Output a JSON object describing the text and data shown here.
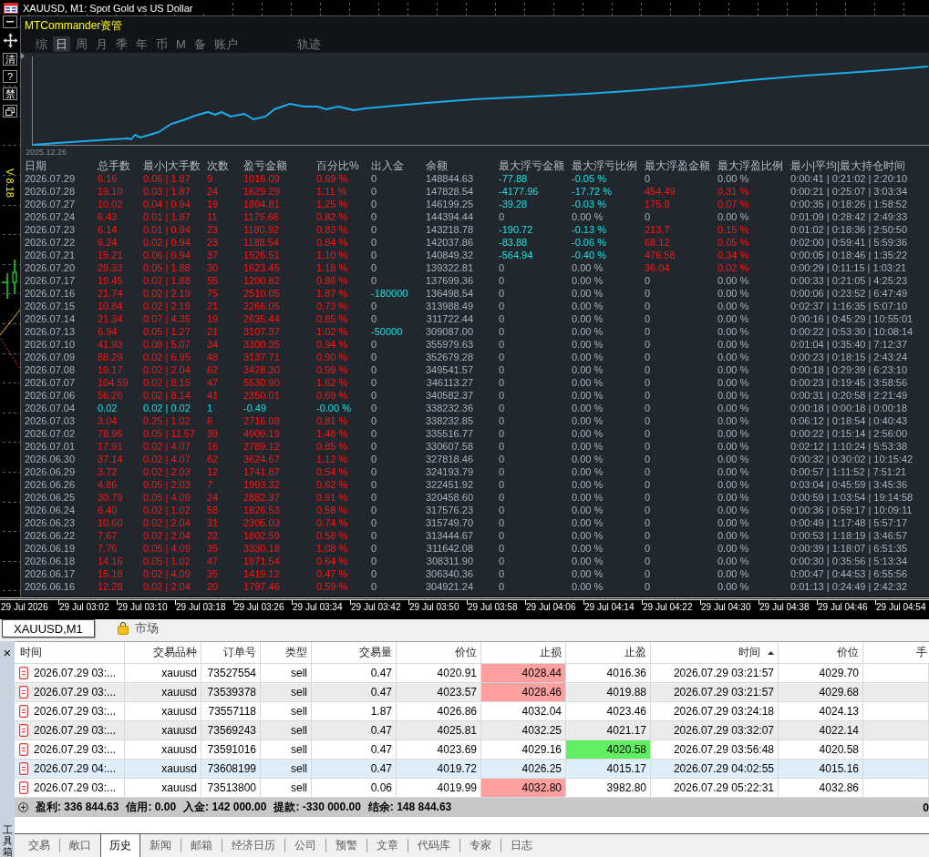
{
  "title_bar": {
    "title": "XAUUSD, M1: Spot Gold vs US Dollar"
  },
  "side_tools": [
    {
      "kind": "minimize"
    },
    {
      "kind": "move"
    },
    {
      "kind": "label",
      "label": "清"
    },
    {
      "kind": "label",
      "label": "?"
    },
    {
      "kind": "label",
      "label": "禁"
    },
    {
      "kind": "restore"
    }
  ],
  "version": "V 8.18",
  "panel": {
    "title": "MTCommander资管",
    "tabs": [
      {
        "label": "综",
        "selected": false
      },
      {
        "label": "日",
        "selected": true
      },
      {
        "label": "周",
        "selected": false
      },
      {
        "label": "月",
        "selected": false
      },
      {
        "label": "季",
        "selected": false
      },
      {
        "label": "年",
        "selected": false
      },
      {
        "label": "币",
        "selected": false
      },
      {
        "label": "M",
        "selected": false
      },
      {
        "label": "备",
        "selected": false
      },
      {
        "label": "账户",
        "selected": false
      }
    ],
    "side_tabs": [
      {
        "label": "轨迹",
        "selected": false
      }
    ],
    "chart_start": "2025.12.26"
  },
  "stats": {
    "columns": [
      "日期",
      "总手数",
      "最小|大手数",
      "次数",
      "盈亏金额",
      "百分比%",
      "出入金",
      "余额",
      "最大浮亏金额",
      "最大浮亏比例",
      "最大浮盈金额",
      "最大浮盈比例",
      "最小|平均|最大持仓时间"
    ],
    "rows": [
      {
        "cells": [
          "2026.07.29",
          "6.16",
          "0.06 | 1.87",
          "9",
          "1016.09",
          "0.69 %",
          "0",
          "148844.63",
          "-77.88",
          "-0.05 %",
          "0",
          "0.00 %",
          "0:00:41 | 0:21:02 | 2:20:10"
        ],
        "negative": false,
        "flow_marked": false,
        "float_loss_marked": true,
        "float_gain_marked": false
      },
      {
        "cells": [
          "2026.07.28",
          "19.10",
          "0.03 | 1.87",
          "24",
          "1629.29",
          "1.11 %",
          "0",
          "147828.54",
          "-4177.96",
          "-17.72 %",
          "454.49",
          "0.31 %",
          "0:00:21 | 0:25:07 | 3:03:34"
        ],
        "negative": false,
        "flow_marked": false,
        "float_loss_marked": true,
        "float_gain_marked": true
      },
      {
        "cells": [
          "2026.07.27",
          "10.02",
          "0.04 | 0.94",
          "19",
          "1804.81",
          "1.25 %",
          "0",
          "146199.25",
          "-39.28",
          "-0.03 %",
          "175.8",
          "0.07 %",
          "0:00:35 | 0:18:26 | 1:58:52"
        ],
        "negative": false,
        "flow_marked": false,
        "float_loss_marked": true,
        "float_gain_marked": true
      },
      {
        "cells": [
          "2026.07.24",
          "6.43",
          "0.01 | 1.87",
          "11",
          "1175.66",
          "0.82 %",
          "0",
          "144394.44",
          "0",
          "0.00 %",
          "0",
          "0.00 %",
          "0:01:09 | 0:28:42 | 2:49:33"
        ],
        "negative": false,
        "flow_marked": false,
        "float_loss_marked": false,
        "float_gain_marked": false
      },
      {
        "cells": [
          "2026.07.23",
          "6.14",
          "0.01 | 0.94",
          "23",
          "1180.92",
          "0.83 %",
          "0",
          "143218.78",
          "-190.72",
          "-0.13 %",
          "213.7",
          "0.15 %",
          "0:01:02 | 0:18:36 | 2:50:50"
        ],
        "negative": false,
        "flow_marked": false,
        "float_loss_marked": true,
        "float_gain_marked": true
      },
      {
        "cells": [
          "2026.07.22",
          "6.24",
          "0.02 | 0.94",
          "23",
          "1188.54",
          "0.84 %",
          "0",
          "142037.86",
          "-83.88",
          "-0.06 %",
          "68.12",
          "0.05 %",
          "0:02:00 | 0:59:41 | 5:59:36"
        ],
        "negative": false,
        "flow_marked": false,
        "float_loss_marked": true,
        "float_gain_marked": true
      },
      {
        "cells": [
          "2026.07.21",
          "15.21",
          "0.06 | 0.94",
          "37",
          "1526.51",
          "1.10 %",
          "0",
          "140849.32",
          "-564.94",
          "-0.40 %",
          "476.58",
          "0.34 %",
          "0:00:05 | 0:18:46 | 1:35:22"
        ],
        "negative": false,
        "flow_marked": false,
        "float_loss_marked": true,
        "float_gain_marked": true
      },
      {
        "cells": [
          "2026.07.20",
          "28.33",
          "0.05 | 1.88",
          "30",
          "1623.45",
          "1.18 %",
          "0",
          "139322.81",
          "0",
          "0.00 %",
          "36.04",
          "0.02 %",
          "0:00:29 | 0:11:15 | 1:03:21"
        ],
        "negative": false,
        "flow_marked": false,
        "float_loss_marked": false,
        "float_gain_marked": true
      },
      {
        "cells": [
          "2026.07.17",
          "19.45",
          "0.02 | 1.88",
          "55",
          "1200.82",
          "0.88 %",
          "0",
          "137699.36",
          "0",
          "0.00 %",
          "0",
          "0.00 %",
          "0:00:33 | 0:21:05 | 4:25:23"
        ],
        "negative": false,
        "flow_marked": false,
        "float_loss_marked": false,
        "float_gain_marked": false
      },
      {
        "cells": [
          "2026.07.16",
          "21.74",
          "0.02 | 2.19",
          "75",
          "2510.05",
          "1.87 %",
          "-180000",
          "136498.54",
          "0",
          "0.00 %",
          "0",
          "0.00 %",
          "0:00:06 | 0:23:52 | 6:47:49"
        ],
        "negative": false,
        "flow_marked": true,
        "float_loss_marked": false,
        "float_gain_marked": false
      },
      {
        "cells": [
          "2026.07.15",
          "10.84",
          "0.02 | 2.19",
          "21",
          "2266.05",
          "0.73 %",
          "0",
          "313988.49",
          "0",
          "0.00 %",
          "0",
          "0.00 %",
          "0:02:37 | 1:16:35 | 5:07:10"
        ],
        "negative": false,
        "flow_marked": false,
        "float_loss_marked": false,
        "float_gain_marked": false
      },
      {
        "cells": [
          "2026.07.14",
          "21.34",
          "0.07 | 4.35",
          "19",
          "2635.44",
          "0.85 %",
          "0",
          "311722.44",
          "0",
          "0.00 %",
          "0",
          "0.00 %",
          "0:00:16 | 0:45:29 | 10:55:01"
        ],
        "negative": false,
        "flow_marked": false,
        "float_loss_marked": false,
        "float_gain_marked": false
      },
      {
        "cells": [
          "2026.07.13",
          "6.94",
          "0.05 | 1.27",
          "21",
          "3107.37",
          "1.02 %",
          "-50000",
          "309087.00",
          "0",
          "0.00 %",
          "0",
          "0.00 %",
          "0:00:22 | 0:53:30 | 10:08:14"
        ],
        "negative": false,
        "flow_marked": true,
        "float_loss_marked": false,
        "float_gain_marked": false
      },
      {
        "cells": [
          "2026.07.10",
          "41.93",
          "0.08 | 5.07",
          "34",
          "3300.35",
          "0.94 %",
          "0",
          "355979.63",
          "0",
          "0.00 %",
          "0",
          "0.00 %",
          "0:01:04 | 0:35:40 | 7:12:37"
        ],
        "negative": false,
        "flow_marked": false,
        "float_loss_marked": false,
        "float_gain_marked": false
      },
      {
        "cells": [
          "2026.07.09",
          "88.29",
          "0.02 | 6.95",
          "48",
          "3137.71",
          "0.90 %",
          "0",
          "352679.28",
          "0",
          "0.00 %",
          "0",
          "0.00 %",
          "0:00:23 | 0:18:15 | 2:43:24"
        ],
        "negative": false,
        "flow_marked": false,
        "float_loss_marked": false,
        "float_gain_marked": false
      },
      {
        "cells": [
          "2026.07.08",
          "19.17",
          "0.02 | 2.04",
          "62",
          "3428.30",
          "0.99 %",
          "0",
          "349541.57",
          "0",
          "0.00 %",
          "0",
          "0.00 %",
          "0:00:18 | 0:29:39 | 6:23:10"
        ],
        "negative": false,
        "flow_marked": false,
        "float_loss_marked": false,
        "float_gain_marked": false
      },
      {
        "cells": [
          "2026.07.07",
          "104.59",
          "0.02 | 8.15",
          "47",
          "5530.90",
          "1.62 %",
          "0",
          "346113.27",
          "0",
          "0.00 %",
          "0",
          "0.00 %",
          "0:00:23 | 0:19:45 | 3:58:56"
        ],
        "negative": false,
        "flow_marked": false,
        "float_loss_marked": false,
        "float_gain_marked": false
      },
      {
        "cells": [
          "2026.07.06",
          "56.26",
          "0.02 | 8.14",
          "41",
          "2350.01",
          "0.69 %",
          "0",
          "340582.37",
          "0",
          "0.00 %",
          "0",
          "0.00 %",
          "0:00:31 | 0:20:58 | 2:21:49"
        ],
        "negative": false,
        "flow_marked": false,
        "float_loss_marked": false,
        "float_gain_marked": false
      },
      {
        "cells": [
          "2026.07.04",
          "0.02",
          "0.02 | 0.02",
          "1",
          "-0.49",
          "-0.00 %",
          "0",
          "338232.36",
          "0",
          "0.00 %",
          "0",
          "0.00 %",
          "0:00:18 | 0:00:18 | 0:00:18"
        ],
        "negative": true,
        "flow_marked": false,
        "float_loss_marked": false,
        "float_gain_marked": false
      },
      {
        "cells": [
          "2026.07.03",
          "3.04",
          "0.25 | 1.02",
          "6",
          "2716.08",
          "0.81 %",
          "0",
          "338232.85",
          "0",
          "0.00 %",
          "0",
          "0.00 %",
          "0:06:12 | 0:18:54 | 0:40:43"
        ],
        "negative": false,
        "flow_marked": false,
        "float_loss_marked": false,
        "float_gain_marked": false
      },
      {
        "cells": [
          "2026.07.02",
          "78.96",
          "0.05 | 11.57",
          "39",
          "4909.19",
          "1.48 %",
          "0",
          "335516.77",
          "0",
          "0.00 %",
          "0",
          "0.00 %",
          "0:00:22 | 0:15:14 | 2:56:00"
        ],
        "negative": false,
        "flow_marked": false,
        "float_loss_marked": false,
        "float_gain_marked": false
      },
      {
        "cells": [
          "2026.07.01",
          "17.91",
          "0.02 | 4.07",
          "16",
          "2789.12",
          "0.85 %",
          "0",
          "330607.58",
          "0",
          "0.00 %",
          "0",
          "0.00 %",
          "0:02:12 | 1:10:24 | 5:53:38"
        ],
        "negative": false,
        "flow_marked": false,
        "float_loss_marked": false,
        "float_gain_marked": false
      },
      {
        "cells": [
          "2026.06.30",
          "37.14",
          "0.02 | 4.07",
          "62",
          "3624.67",
          "1.12 %",
          "0",
          "327818.46",
          "0",
          "0.00 %",
          "0",
          "0.00 %",
          "0:00:32 | 0:30:02 | 10:15:42"
        ],
        "negative": false,
        "flow_marked": false,
        "float_loss_marked": false,
        "float_gain_marked": false
      },
      {
        "cells": [
          "2026.06.29",
          "3.72",
          "0.02 | 2.03",
          "12",
          "1741.87",
          "0.54 %",
          "0",
          "324193.79",
          "0",
          "0.00 %",
          "0",
          "0.00 %",
          "0:00:57 | 1:11:52 | 7:51:21"
        ],
        "negative": false,
        "flow_marked": false,
        "float_loss_marked": false,
        "float_gain_marked": false
      },
      {
        "cells": [
          "2026.06.26",
          "4.86",
          "0.05 | 2.03",
          "7",
          "1993.32",
          "0.62 %",
          "0",
          "322451.92",
          "0",
          "0.00 %",
          "0",
          "0.00 %",
          "0:03:04 | 0:45:59 | 3:45:36"
        ],
        "negative": false,
        "flow_marked": false,
        "float_loss_marked": false,
        "float_gain_marked": false
      },
      {
        "cells": [
          "2026.06.25",
          "30.79",
          "0.05 | 4.09",
          "24",
          "2882.37",
          "0.91 %",
          "0",
          "320458.60",
          "0",
          "0.00 %",
          "0",
          "0.00 %",
          "0:00:59 | 1:03:54 | 19:14:58"
        ],
        "negative": false,
        "flow_marked": false,
        "float_loss_marked": false,
        "float_gain_marked": false
      },
      {
        "cells": [
          "2026.06.24",
          "6.40",
          "0.02 | 1.02",
          "58",
          "1826.53",
          "0.58 %",
          "0",
          "317576.23",
          "0",
          "0.00 %",
          "0",
          "0.00 %",
          "0:00:36 | 0:59:17 | 10:09:11"
        ],
        "negative": false,
        "flow_marked": false,
        "float_loss_marked": false,
        "float_gain_marked": false
      },
      {
        "cells": [
          "2026.06.23",
          "10.60",
          "0.02 | 2.04",
          "31",
          "2305.03",
          "0.74 %",
          "0",
          "315749.70",
          "0",
          "0.00 %",
          "0",
          "0.00 %",
          "0:00:49 | 1:17:48 | 5:57:17"
        ],
        "negative": false,
        "flow_marked": false,
        "float_loss_marked": false,
        "float_gain_marked": false
      },
      {
        "cells": [
          "2026.06.22",
          "7.67",
          "0.02 | 2.04",
          "22",
          "1802.59",
          "0.58 %",
          "0",
          "313444.67",
          "0",
          "0.00 %",
          "0",
          "0.00 %",
          "0:00:53 | 1:18:19 | 3:46:57"
        ],
        "negative": false,
        "flow_marked": false,
        "float_loss_marked": false,
        "float_gain_marked": false
      },
      {
        "cells": [
          "2026.06.19",
          "7.76",
          "0.05 | 4.09",
          "35",
          "3330.18",
          "1.08 %",
          "0",
          "311642.08",
          "0",
          "0.00 %",
          "0",
          "0.00 %",
          "0:00:39 | 1:18:07 | 6:51:35"
        ],
        "negative": false,
        "flow_marked": false,
        "float_loss_marked": false,
        "float_gain_marked": false
      },
      {
        "cells": [
          "2026.06.18",
          "14.16",
          "0.05 | 1.02",
          "47",
          "1971.54",
          "0.64 %",
          "0",
          "308311.90",
          "0",
          "0.00 %",
          "0",
          "0.00 %",
          "0:00:30 | 0:35:56 | 5:13:34"
        ],
        "negative": false,
        "flow_marked": false,
        "float_loss_marked": false,
        "float_gain_marked": false
      },
      {
        "cells": [
          "2026.06.17",
          "15.18",
          "0.02 | 4.09",
          "35",
          "1419.12",
          "0.47 %",
          "0",
          "306340.36",
          "0",
          "0.00 %",
          "0",
          "0.00 %",
          "0:00:47 | 0:44:53 | 6:55:56"
        ],
        "negative": false,
        "flow_marked": false,
        "float_loss_marked": false,
        "float_gain_marked": false
      },
      {
        "cells": [
          "2026.06.16",
          "12.28",
          "0.02 | 2.04",
          "20",
          "1797.46",
          "0.59 %",
          "0",
          "304921.24",
          "0",
          "0.00 %",
          "0",
          "0.00 %",
          "0:01:13 | 0:24:49 | 2:42:32"
        ],
        "negative": false,
        "flow_marked": false,
        "float_loss_marked": false,
        "float_gain_marked": false
      }
    ]
  },
  "time_axis": [
    "29 Jul 2026",
    "29 Jul 03:02",
    "29 Jul 03:10",
    "29 Jul 03:18",
    "29 Jul 03:26",
    "29 Jul 03:34",
    "29 Jul 03:42",
    "29 Jul 03:50",
    "29 Jul 03:58",
    "29 Jul 04:06",
    "29 Jul 04:14",
    "29 Jul 04:22",
    "29 Jul 04:30",
    "29 Jul 04:38",
    "29 Jul 04:46",
    "29 Jul 04:54"
  ],
  "chart_tabs": [
    {
      "label": "XAUUSD,M1",
      "selected": true,
      "kind": "chart"
    },
    {
      "label": "市场",
      "selected": false,
      "kind": "market"
    }
  ],
  "history": {
    "columns": [
      {
        "label": "时间",
        "sorted": false
      },
      {
        "label": "交易品种",
        "sorted": false
      },
      {
        "label": "订单号",
        "sorted": false
      },
      {
        "label": "类型",
        "sorted": false
      },
      {
        "label": "交易量",
        "sorted": false
      },
      {
        "label": "价位",
        "sorted": false
      },
      {
        "label": "止损",
        "sorted": false
      },
      {
        "label": "止盈",
        "sorted": false
      },
      {
        "label": "时间",
        "sorted": true
      },
      {
        "label": "价位",
        "sorted": false
      },
      {
        "label": "手",
        "sorted": false
      }
    ],
    "rows": [
      {
        "cells": [
          "2026.07.29 03:...",
          "xauusd",
          "73527554",
          "sell",
          "0.47",
          "4020.91",
          "4028.44",
          "4016.36",
          "2026.07.29 03:21:57",
          "4029.70"
        ],
        "selected": false,
        "sl_hit": true,
        "tp_hit": false
      },
      {
        "cells": [
          "2026.07.29 03:...",
          "xauusd",
          "73539378",
          "sell",
          "0.47",
          "4023.57",
          "4028.46",
          "4019.88",
          "2026.07.29 03:21:57",
          "4029.68"
        ],
        "selected": false,
        "sl_hit": true,
        "tp_hit": false
      },
      {
        "cells": [
          "2026.07.29 03:...",
          "xauusd",
          "73557118",
          "sell",
          "1.87",
          "4026.86",
          "4032.04",
          "4023.46",
          "2026.07.29 03:24:18",
          "4024.13"
        ],
        "selected": false,
        "sl_hit": false,
        "tp_hit": false
      },
      {
        "cells": [
          "2026.07.29 03:...",
          "xauusd",
          "73569243",
          "sell",
          "0.47",
          "4025.81",
          "4032.25",
          "4021.17",
          "2026.07.29 03:32:07",
          "4022.14"
        ],
        "selected": false,
        "sl_hit": false,
        "tp_hit": false
      },
      {
        "cells": [
          "2026.07.29 03:...",
          "xauusd",
          "73591016",
          "sell",
          "0.47",
          "4023.69",
          "4029.16",
          "4020.58",
          "2026.07.29 03:56:48",
          "4020.58"
        ],
        "selected": false,
        "sl_hit": false,
        "tp_hit": true
      },
      {
        "cells": [
          "2026.07.29 04:...",
          "xauusd",
          "73608199",
          "sell",
          "0.47",
          "4019.72",
          "4026.25",
          "4015.17",
          "2026.07.29 04:02:55",
          "4015.16"
        ],
        "selected": true,
        "sl_hit": false,
        "tp_hit": false
      },
      {
        "cells": [
          "2026.07.29 03:...",
          "xauusd",
          "73513800",
          "sell",
          "0.06",
          "4019.99",
          "4032.80",
          "3982.80",
          "2026.07.29 05:22:31",
          "4032.86"
        ],
        "selected": false,
        "sl_hit": true,
        "tp_hit": false
      }
    ],
    "summary": {
      "items": [
        "盈利: 336 844.63",
        "信用: 0.00",
        "入金: 142 000.00",
        "提款: -330 000.00",
        "结余: 148 844.63"
      ],
      "trailing": "0"
    }
  },
  "toolbox": {
    "close": "×",
    "label": "工具箱",
    "tabs": [
      {
        "label": "交易",
        "selected": false
      },
      {
        "label": "敞口",
        "selected": false
      },
      {
        "label": "历史",
        "selected": true
      },
      {
        "label": "新闻",
        "selected": false
      },
      {
        "label": "邮箱",
        "selected": false
      },
      {
        "label": "经济日历",
        "selected": false
      },
      {
        "label": "公司",
        "selected": false
      },
      {
        "label": "预警",
        "selected": false
      },
      {
        "label": "文章",
        "selected": false
      },
      {
        "label": "代码库",
        "selected": false
      },
      {
        "label": "专家",
        "selected": false
      },
      {
        "label": "日志",
        "selected": false
      }
    ]
  }
}
